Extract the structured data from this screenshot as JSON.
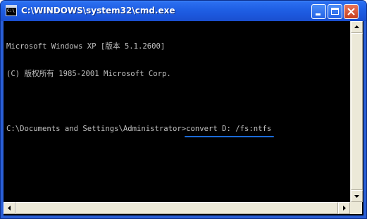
{
  "window": {
    "title": "C:\\WINDOWS\\system32\\cmd.exe",
    "icon_label": "C:\\",
    "controls": {
      "minimize": "minimize",
      "maximize": "maximize",
      "close": "close"
    }
  },
  "console": {
    "lines": [
      "Microsoft Windows XP [版本 5.1.2600]",
      "(C) 版权所有 1985-2001 Microsoft Corp.",
      "",
      "C:\\Documents and Settings\\Administrator>"
    ],
    "command": "convert D: /fs:ntfs"
  },
  "colors": {
    "console_bg": "#000000",
    "console_text": "#c0c0c0",
    "titlebar": "#1f5fe4",
    "highlight_underline": "#1a6ad8"
  }
}
